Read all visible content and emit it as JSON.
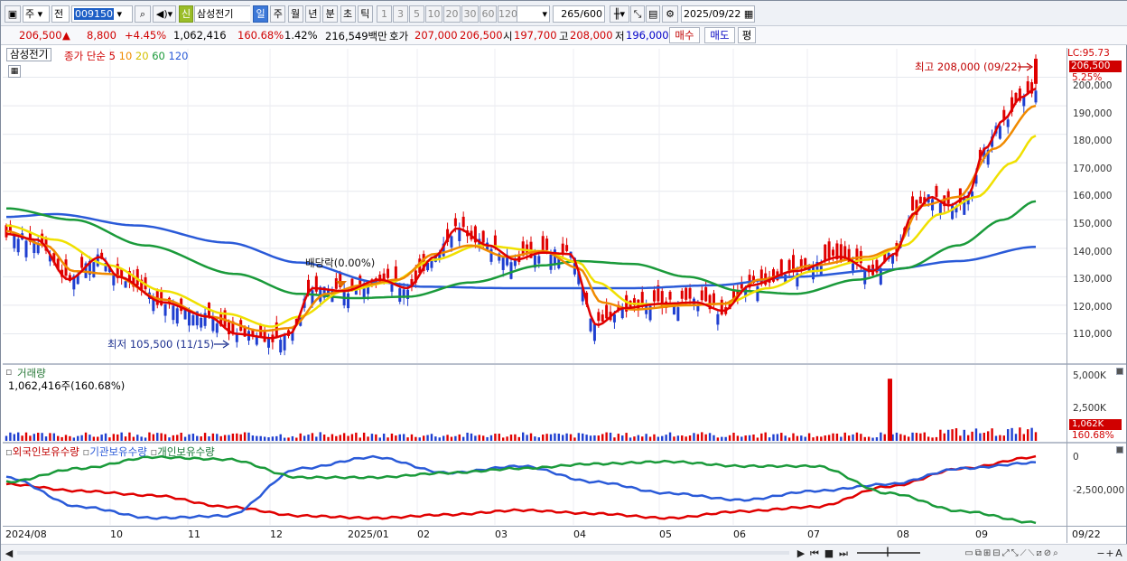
{
  "toolbar": {
    "menu_icon": "window-icon",
    "market": "주",
    "scope": "전",
    "code": "009150",
    "search_icon": "search-icon",
    "speaker_icon": "speaker-icon",
    "credit_badge": "신",
    "stock_name": "삼성전기",
    "periods": [
      "일",
      "주",
      "월",
      "년",
      "분",
      "초",
      "틱"
    ],
    "selected_period": "일",
    "intervals": [
      "1",
      "3",
      "5",
      "10",
      "20",
      "30",
      "60",
      "120"
    ],
    "count": "265",
    "count_max": "/600",
    "date": "2025/09/22"
  },
  "infobar": {
    "price": "206,500",
    "arrow": "▲",
    "change": "8,800",
    "change_pct": "+4.45%",
    "volume": "1,062,416",
    "volume_ratio": "160.68%",
    "turnover": "1.42%",
    "amount": "216,549백만",
    "ask_label": "호가",
    "ask": "207,000",
    "bid": "206,500",
    "open_label": "시",
    "open": "197,700",
    "high_label": "고",
    "high": "208,000",
    "low_label": "저",
    "low": "196,000",
    "buy_button": "매수",
    "sell_button": "매도",
    "eval_button": "평"
  },
  "price_panel": {
    "stock_tag": "삼성전기",
    "ma_label": "종가 단순",
    "ma_periods": [
      "5",
      "10",
      "20",
      "60",
      "120"
    ],
    "ma_colors": [
      "#e00000",
      "#f08a00",
      "#f0e000",
      "#1a9a3a",
      "#2a5ad8"
    ],
    "lc_label": "LC:95.73",
    "last_price_tag": "206,500",
    "last_pct_tag": "5.25%",
    "high_annotation": "최고 208,000 (09/22)",
    "low_annotation": "최저 105,500 (11/15)",
    "dividend_annotation": "배당락(0.00%)",
    "y_ticks": [
      "200,000",
      "190,000",
      "180,000",
      "170,000",
      "160,000",
      "150,000",
      "140,000",
      "130,000",
      "120,000",
      "110,000"
    ]
  },
  "volume_panel": {
    "title": "거래량",
    "value_label": "1,062,416주(160.68%)",
    "y_ticks": [
      "5,000K",
      "2,500K"
    ],
    "last_tag": "1,062K",
    "last_pct_tag": "160.68%"
  },
  "holdings_panel": {
    "legend": [
      "외국인보유수량",
      "기관보유수량",
      "개인보유수량"
    ],
    "colors": [
      "#e00000",
      "#2a5ad8",
      "#1a9a3a"
    ],
    "y_ticks": [
      "0",
      "-2,500,000"
    ]
  },
  "x_axis": [
    "2024/08",
    "10",
    "11",
    "12",
    "2025/01",
    "02",
    "03",
    "04",
    "05",
    "06",
    "07",
    "08",
    "09"
  ],
  "x_axis_right": "09/22",
  "chart_data": {
    "type": "candlestick",
    "title": "삼성전기",
    "ylim": [
      100000,
      210000
    ],
    "x": [
      "2024/08",
      "10",
      "11",
      "12",
      "2025/01",
      "02",
      "03",
      "04",
      "05",
      "06",
      "07",
      "08",
      "09",
      "09/22"
    ],
    "series": [
      {
        "name": "5",
        "values": [
          145000,
          140000,
          128000,
          135000,
          130000,
          118000,
          110000,
          108000,
          124000,
          126000,
          145000,
          140000,
          138000,
          110000,
          120000,
          118000,
          127000,
          130000,
          137000,
          160000,
          157000,
          195000,
          206500
        ]
      },
      {
        "name": "120",
        "values": [
          151000,
          152000,
          151000,
          148000,
          145000,
          141000,
          137000,
          133000,
          129000,
          127000,
          126000,
          126000,
          126000,
          126000,
          126500,
          127000,
          128000,
          130000,
          131000,
          133000,
          137000,
          141000
        ]
      }
    ],
    "volume": {
      "last": 1062416,
      "peak": 5000000
    },
    "holdings": {
      "ylim": [
        -3000000,
        200000
      ],
      "series": [
        {
          "name": "외국인보유수량",
          "values": [
            -1200000,
            -1500000,
            -1700000,
            -2200000,
            -2600000,
            -2700000,
            -2550000,
            -2350000,
            -2500000,
            -2700000,
            -2400000,
            -2200000,
            -1300000,
            -500000,
            0
          ]
        },
        {
          "name": "기관보유수량",
          "values": [
            -900000,
            -2200000,
            -2700000,
            -2600000,
            -500000,
            0,
            -700000,
            -400000,
            -1100000,
            -1600000,
            -1900000,
            -1500000,
            -1200000,
            -500000,
            -250000
          ]
        },
        {
          "name": "개인보유수량",
          "values": [
            -1100000,
            -500000,
            0,
            -100000,
            -900000,
            -900000,
            -700000,
            -500000,
            -300000,
            -200000,
            -400000,
            -400000,
            -1600000,
            -2400000,
            -2900000
          ]
        }
      ]
    }
  }
}
